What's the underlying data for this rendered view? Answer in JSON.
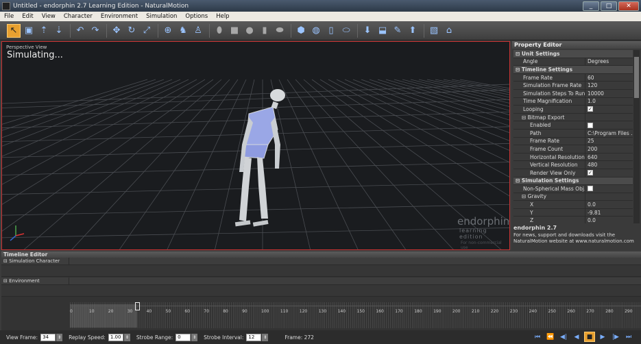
{
  "window": {
    "title": "Untitled - endorphin 2.7 Learning Edition - NaturalMotion",
    "min": "_",
    "max": "□",
    "close": "✕"
  },
  "menu": [
    "File",
    "Edit",
    "View",
    "Character",
    "Environment",
    "Simulation",
    "Options",
    "Help"
  ],
  "toolbar": {
    "icons": [
      "select-icon",
      "save-icon",
      "import-icon",
      "export-icon",
      "undo-icon",
      "redo-icon",
      "move-icon",
      "rotate-icon",
      "scale-icon",
      "joint-icon",
      "character-icon",
      "pose-icon",
      "capsule-icon",
      "box-icon",
      "sphere-icon",
      "cylinder-icon",
      "ellipsoid-icon",
      "shield-icon",
      "globe-icon",
      "pillar-icon",
      "link-icon",
      "pin-icon",
      "key-icon",
      "brush-icon",
      "paint-icon",
      "image-icon",
      "camera-icon"
    ],
    "glyphs": [
      "↖",
      "▣",
      "⇡",
      "⇣",
      "↶",
      "↷",
      "✥",
      "↻",
      "⤢",
      "⊕",
      "♞",
      "♙",
      "⬮",
      "■",
      "●",
      "▮",
      "⬬",
      "⬢",
      "◍",
      "▯",
      "⬭",
      "⬇",
      "⬓",
      "✎",
      "⬆",
      "▧",
      "⌂"
    ]
  },
  "viewport": {
    "label": "Perspective View",
    "status": "Simulating...",
    "logo_main": "endorphin",
    "logo_sub": "learning edition",
    "logo_note": "For non-commercial use"
  },
  "property_editor": {
    "title": "Property Editor",
    "rows": [
      {
        "kind": "section",
        "key": "⊟  Unit Settings",
        "value": ""
      },
      {
        "kind": "row",
        "key": "Angle",
        "value": "Degrees"
      },
      {
        "kind": "section",
        "key": "⊟  Timeline Settings",
        "value": ""
      },
      {
        "kind": "row",
        "key": "Frame Rate",
        "value": "60"
      },
      {
        "kind": "row",
        "key": "Simulation Frame Rate",
        "value": "120"
      },
      {
        "kind": "row",
        "key": "Simulation Steps To Run",
        "value": "10000"
      },
      {
        "kind": "row",
        "key": "Time Magnification",
        "value": "1.0"
      },
      {
        "kind": "row",
        "key": "Looping",
        "value": "",
        "check": true
      },
      {
        "kind": "group",
        "key": "⊟ Bitmap Export",
        "value": ""
      },
      {
        "kind": "sub",
        "key": "Enabled",
        "value": "",
        "check": false
      },
      {
        "kind": "sub",
        "key": "Path",
        "value": "C:\\Program Files ..."
      },
      {
        "kind": "sub",
        "key": "Frame Rate",
        "value": "25"
      },
      {
        "kind": "sub",
        "key": "Frame Count",
        "value": "200"
      },
      {
        "kind": "sub",
        "key": "Horizontal Resolution",
        "value": "640"
      },
      {
        "kind": "sub",
        "key": "Vertical Resolution",
        "value": "480"
      },
      {
        "kind": "sub",
        "key": "Render View Only",
        "value": "",
        "check": true
      },
      {
        "kind": "section",
        "key": "⊟  Simulation Settings",
        "value": ""
      },
      {
        "kind": "row",
        "key": "Non-Spherical Mass Obj...",
        "value": "",
        "check": false
      },
      {
        "kind": "group",
        "key": "⊟ Gravity",
        "value": ""
      },
      {
        "kind": "sub",
        "key": "X",
        "value": "0.0"
      },
      {
        "kind": "sub",
        "key": "Y",
        "value": "-9.81"
      },
      {
        "kind": "sub",
        "key": "Z",
        "value": "0.0"
      }
    ],
    "info_title": "endorphin 2.7",
    "info_text": "For news, support and downloads visit the NaturalMotion website at www.naturalmotion.com"
  },
  "timeline": {
    "title": "Timeline Editor",
    "tracks": [
      "⊟ Simulation Character",
      "⊟ Environment"
    ],
    "ticks": [
      "0",
      "10",
      "20",
      "30",
      "40",
      "50",
      "60",
      "70",
      "80",
      "90",
      "100",
      "110",
      "120",
      "130",
      "140",
      "150",
      "160",
      "170",
      "180",
      "190",
      "200",
      "210",
      "220",
      "230",
      "240",
      "250",
      "260",
      "270",
      "280",
      "290"
    ],
    "view_frame_label": "View Frame:",
    "view_frame": "34",
    "replay_speed_label": "Replay Speed:",
    "replay_speed": "1.00",
    "strobe_range_label": "Strobe Range:",
    "strobe_range": "0",
    "strobe_interval_label": "Strobe Interval:",
    "strobe_interval": "12",
    "frame_label": "Frame: 272",
    "playback": [
      "⏮",
      "⏪",
      "◀|",
      "◀",
      "■",
      "▶",
      "|▶",
      "⏭"
    ]
  }
}
